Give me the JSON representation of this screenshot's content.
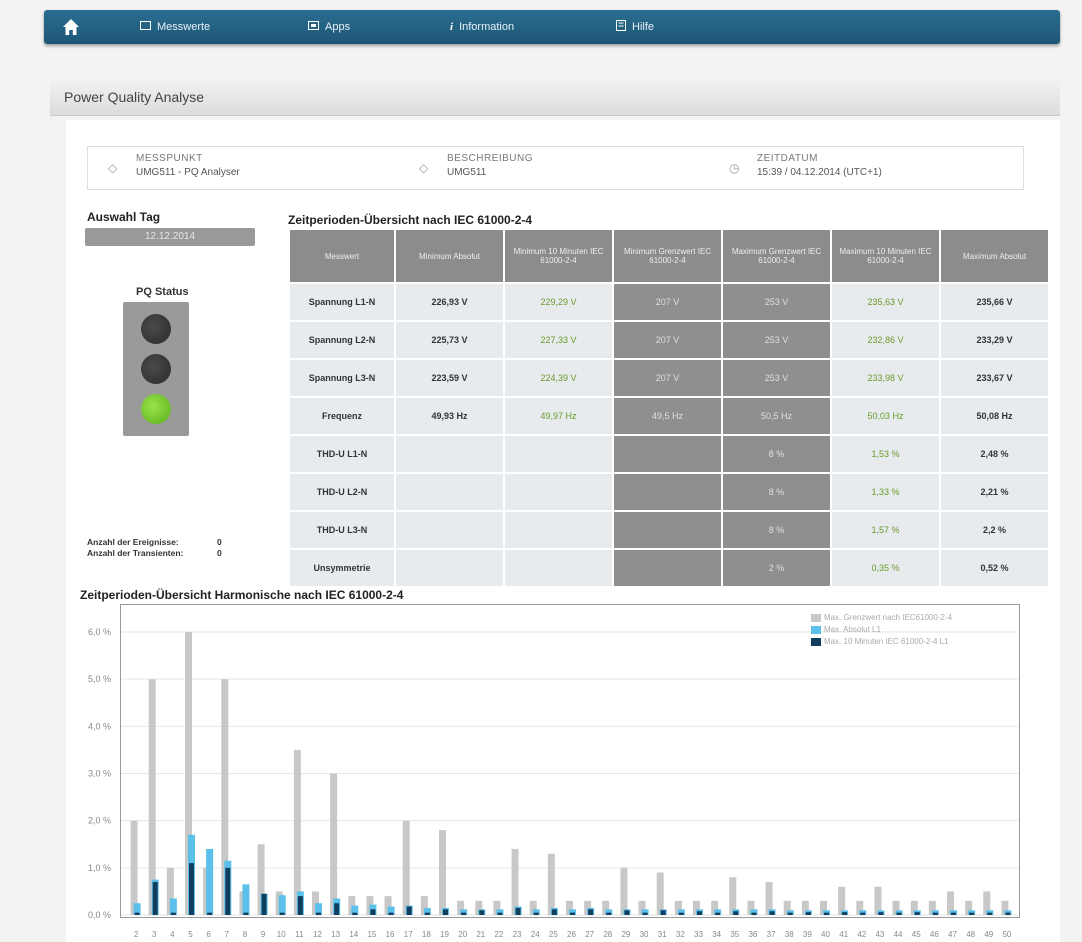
{
  "nav": {
    "items": [
      {
        "label": "Messwerte",
        "icon": "monitor-icon"
      },
      {
        "label": "Apps",
        "icon": "apps-icon"
      },
      {
        "label": "Information",
        "icon": "info-icon"
      },
      {
        "label": "Hilfe",
        "icon": "help-icon"
      }
    ]
  },
  "page_title": "Power Quality Analyse",
  "info": {
    "messpunkt_label": "MESSPUNKT",
    "messpunkt_value": "UMG511 - PQ Analyser",
    "beschreibung_label": "BESCHREIBUNG",
    "beschreibung_value": "UMG511",
    "zeitdatum_label": "ZEITDATUM",
    "zeitdatum_value": "15:39 / 04.12.2014 (UTC+1)"
  },
  "left": {
    "auswahl_tag_label": "Auswahl Tag",
    "auswahl_tag_value": "12.12.2014",
    "pq_status_label": "PQ Status",
    "pq_status_lamps": [
      "off",
      "off",
      "green"
    ],
    "ereignisse_label": "Anzahl der Ereignisse:",
    "ereignisse_value": "0",
    "transienten_label": "Anzahl der Transienten:",
    "transienten_value": "0"
  },
  "table": {
    "title": "Zeitperioden-Übersicht nach IEC 61000-2-4",
    "headers": [
      "Messwert",
      "Minimum Absolut",
      "Minimum 10 Minuten IEC 61000-2-4",
      "Minimum Grenzwert IEC 61000-2-4",
      "Maximum Grenzwert IEC 61000-2-4",
      "Maximum 10 Minuten IEC 61000-2-4",
      "Maximum Absolut"
    ],
    "rows": [
      [
        "Spannung L1-N",
        "226,93 V",
        "229,29 V",
        "207 V",
        "253 V",
        "235,63 V",
        "235,66 V"
      ],
      [
        "Spannung L2-N",
        "225,73 V",
        "227,33 V",
        "207 V",
        "253 V",
        "232,86 V",
        "233,29 V"
      ],
      [
        "Spannung L3-N",
        "223,59 V",
        "224,39 V",
        "207 V",
        "253 V",
        "233,98 V",
        "233,67 V"
      ],
      [
        "Frequenz",
        "49,93 Hz",
        "49,97 Hz",
        "49,5 Hz",
        "50,5 Hz",
        "50,03 Hz",
        "50,08 Hz"
      ],
      [
        "THD-U L1-N",
        "",
        "",
        "",
        "8 %",
        "1,53 %",
        "2,48 %"
      ],
      [
        "THD-U L2-N",
        "",
        "",
        "",
        "8 %",
        "1,33 %",
        "2,21 %"
      ],
      [
        "THD-U L3-N",
        "",
        "",
        "",
        "8 %",
        "1,57 %",
        "2,2 %"
      ],
      [
        "Unsymmetrie",
        "",
        "",
        "",
        "2 %",
        "0,35 %",
        "0,52 %"
      ]
    ]
  },
  "chart_data": {
    "type": "bar",
    "title": "Zeitperioden-Übersicht Harmonische nach IEC 61000-2-4",
    "xlabel": "",
    "ylabel": "",
    "ylim": [
      0,
      6
    ],
    "yticks": [
      "0,0 %",
      "1,0 %",
      "2,0 %",
      "3,0 %",
      "4,0 %",
      "5,0 %",
      "6,0 %"
    ],
    "categories": [
      "2",
      "3",
      "4",
      "5",
      "6",
      "7",
      "8",
      "9",
      "10",
      "11",
      "12",
      "13",
      "14",
      "15",
      "16",
      "17",
      "18",
      "19",
      "20",
      "21",
      "22",
      "23",
      "24",
      "25",
      "26",
      "27",
      "28",
      "29",
      "30",
      "31",
      "32",
      "33",
      "34",
      "35",
      "36",
      "37",
      "38",
      "39",
      "40",
      "41",
      "42",
      "43",
      "44",
      "45",
      "46",
      "47",
      "48",
      "49",
      "50"
    ],
    "series": [
      {
        "name": "Max. Grenzwert nach IEC61000-2-4",
        "color": "#c8c8c8",
        "values": [
          2.0,
          5.0,
          1.0,
          6.0,
          1.0,
          5.0,
          0.5,
          1.5,
          0.5,
          3.5,
          0.5,
          3.0,
          0.4,
          0.4,
          0.4,
          2.0,
          0.4,
          1.8,
          0.3,
          0.3,
          0.3,
          1.4,
          0.3,
          1.3,
          0.3,
          0.3,
          0.3,
          1.0,
          0.3,
          0.9,
          0.3,
          0.3,
          0.3,
          0.8,
          0.3,
          0.7,
          0.3,
          0.3,
          0.3,
          0.6,
          0.3,
          0.6,
          0.3,
          0.3,
          0.3,
          0.5,
          0.3,
          0.5,
          0.3
        ]
      },
      {
        "name": "Max. Absolut L1",
        "color": "#5bc0ea",
        "values": [
          0.25,
          0.75,
          0.35,
          1.7,
          1.4,
          1.15,
          0.65,
          0.45,
          0.42,
          0.5,
          0.25,
          0.35,
          0.2,
          0.22,
          0.18,
          0.2,
          0.15,
          0.15,
          0.12,
          0.12,
          0.12,
          0.18,
          0.12,
          0.15,
          0.12,
          0.15,
          0.12,
          0.12,
          0.12,
          0.12,
          0.12,
          0.12,
          0.12,
          0.12,
          0.12,
          0.12,
          0.1,
          0.1,
          0.1,
          0.1,
          0.1,
          0.1,
          0.1,
          0.1,
          0.1,
          0.1,
          0.1,
          0.1,
          0.1
        ]
      },
      {
        "name": "Max. 10 Minuten IEC 61000-2-4 L1",
        "color": "#0f3f5c",
        "values": [
          0.05,
          0.7,
          0.05,
          1.1,
          0.05,
          1.0,
          0.05,
          0.45,
          0.05,
          0.4,
          0.05,
          0.25,
          0.05,
          0.12,
          0.05,
          0.18,
          0.05,
          0.12,
          0.05,
          0.1,
          0.05,
          0.15,
          0.05,
          0.12,
          0.05,
          0.12,
          0.05,
          0.1,
          0.05,
          0.1,
          0.05,
          0.08,
          0.05,
          0.08,
          0.05,
          0.08,
          0.05,
          0.06,
          0.05,
          0.06,
          0.05,
          0.06,
          0.05,
          0.06,
          0.05,
          0.05,
          0.05,
          0.05,
          0.05
        ]
      }
    ]
  }
}
